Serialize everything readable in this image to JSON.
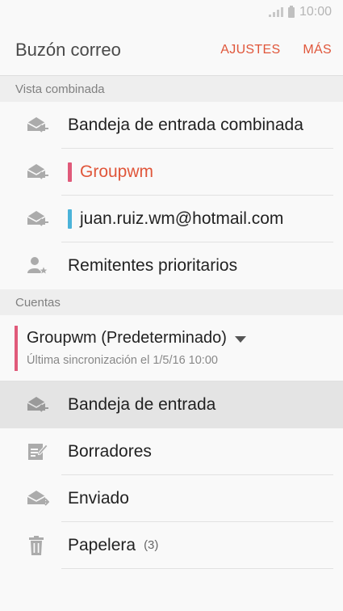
{
  "status_bar": {
    "time": "10:00"
  },
  "app_bar": {
    "title": "Buzón correo",
    "settings_label": "AJUSTES",
    "more_label": "MÁS"
  },
  "combined": {
    "header": "Vista combinada",
    "items": [
      {
        "label": "Bandeja de entrada combinada",
        "icon": "inbox-icon"
      },
      {
        "label": "Groupwm",
        "icon": "inbox-icon",
        "bar_color": "#e05a7a"
      },
      {
        "label": "juan.ruiz.wm@hotmail.com",
        "icon": "inbox-icon",
        "bar_color": "#4bb3d9"
      },
      {
        "label": "Remitentes prioritarios",
        "icon": "priority-sender-icon"
      }
    ]
  },
  "accounts": {
    "header": "Cuentas",
    "account_name": "Groupwm (Predeterminado)",
    "account_sync": "Última sincronización el 1/5/16 10:00",
    "account_color": "#e05a7a",
    "folders": [
      {
        "label": "Bandeja de entrada",
        "icon": "inbox-icon",
        "selected": true
      },
      {
        "label": "Borradores",
        "icon": "drafts-icon"
      },
      {
        "label": "Enviado",
        "icon": "sent-icon"
      },
      {
        "label": "Papelera",
        "icon": "trash-icon",
        "count": "(3)"
      }
    ]
  },
  "colors": {
    "accent": "#e0563a",
    "icon_gray": "#a8a8a8"
  }
}
